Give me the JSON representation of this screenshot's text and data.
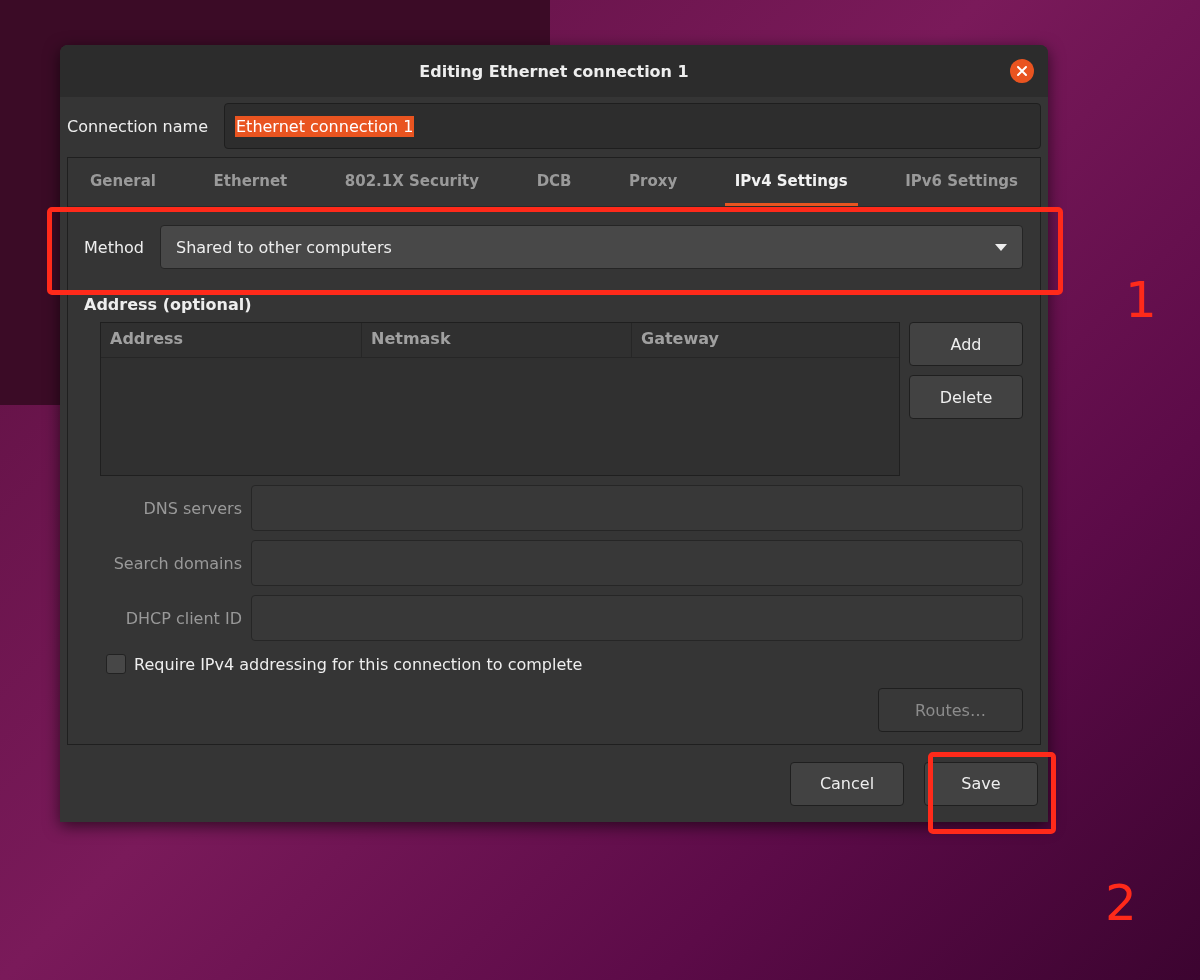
{
  "window": {
    "title": "Editing Ethernet connection 1"
  },
  "connection_name": {
    "label": "Connection name",
    "value": "Ethernet connection 1",
    "selected_text": true
  },
  "tabs": [
    {
      "label": "General",
      "selected": false
    },
    {
      "label": "Ethernet",
      "selected": false
    },
    {
      "label": "802.1X Security",
      "selected": false
    },
    {
      "label": "DCB",
      "selected": false
    },
    {
      "label": "Proxy",
      "selected": false
    },
    {
      "label": "IPv4 Settings",
      "selected": true
    },
    {
      "label": "IPv6 Settings",
      "selected": false
    }
  ],
  "method": {
    "label": "Method",
    "value": "Shared to other computers"
  },
  "address_section": {
    "title": "Address (optional)",
    "columns": [
      "Address",
      "Netmask",
      "Gateway"
    ],
    "buttons": [
      "Add",
      "Delete"
    ]
  },
  "fields": [
    {
      "label": "DNS servers",
      "disabled": true
    },
    {
      "label": "Search domains",
      "disabled": true
    },
    {
      "label": "DHCP client ID",
      "disabled": true
    }
  ],
  "require_checkbox": {
    "label": "Require IPv4 addressing for this connection to complete",
    "checked": false
  },
  "routes_button": {
    "label": "Routes…",
    "disabled": true
  },
  "footer_buttons": [
    {
      "label": "Cancel"
    },
    {
      "label": "Save"
    }
  ],
  "annotations": [
    {
      "label": "1"
    },
    {
      "label": "2"
    }
  ]
}
